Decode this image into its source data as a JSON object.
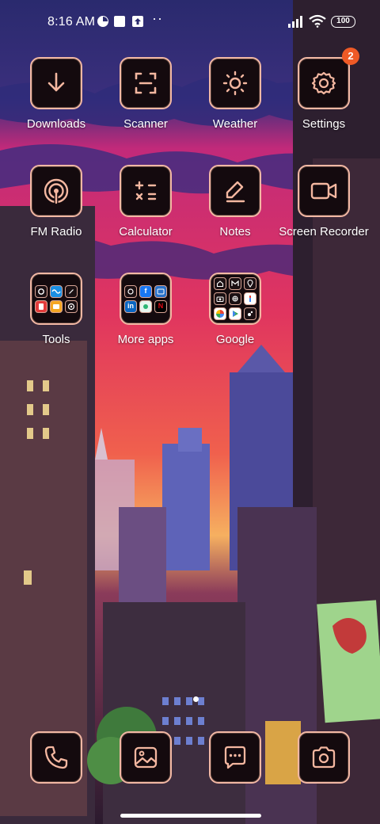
{
  "status_bar": {
    "time": "8:16 AM",
    "notification_icons": [
      "pie-chart-icon",
      "square-icon",
      "upload-icon"
    ],
    "overflow_dots": "··",
    "battery_level": "100"
  },
  "apps": [
    {
      "label": "Downloads",
      "icon": "download-icon"
    },
    {
      "label": "Scanner",
      "icon": "scan-icon"
    },
    {
      "label": "Weather",
      "icon": "sun-icon"
    },
    {
      "label": "Settings",
      "icon": "gear-icon",
      "badge": "2"
    },
    {
      "label": "FM Radio",
      "icon": "radio-icon"
    },
    {
      "label": "Calculator",
      "icon": "calculator-icon"
    },
    {
      "label": "Notes",
      "icon": "pen-icon"
    },
    {
      "label": "Screen Recorder",
      "icon": "video-camera-icon"
    }
  ],
  "folders": [
    {
      "label": "Tools",
      "icons": [
        "settings-icon",
        "waves-icon",
        "compass-icon",
        "red-app-icon",
        "orange-app-icon",
        "target-icon"
      ]
    },
    {
      "label": "More apps",
      "icons": [
        "app-icon",
        "facebook-icon",
        "browser-icon",
        "linkedin-icon",
        "fabby-icon",
        "netflix-icon"
      ],
      "glyphs": [
        "",
        "f",
        "",
        "in",
        "",
        "N"
      ]
    },
    {
      "label": "Google",
      "icons": [
        "home-icon",
        "gmail-icon",
        "maps-icon",
        "camera-icon",
        "assistant-icon",
        "one-icon",
        "photos-icon",
        "play-icon",
        "duo-icon"
      ]
    }
  ],
  "dock": [
    {
      "name": "phone",
      "icon": "phone-icon"
    },
    {
      "name": "gallery",
      "icon": "image-icon"
    },
    {
      "name": "messages",
      "icon": "chat-bubble-icon"
    },
    {
      "name": "camera",
      "icon": "camera-icon"
    }
  ],
  "colors": {
    "tile_bg": "#140a0e",
    "tile_border": "#f2b8a4",
    "icon_stroke": "#f4b7a0",
    "badge": "#ef5a26"
  }
}
